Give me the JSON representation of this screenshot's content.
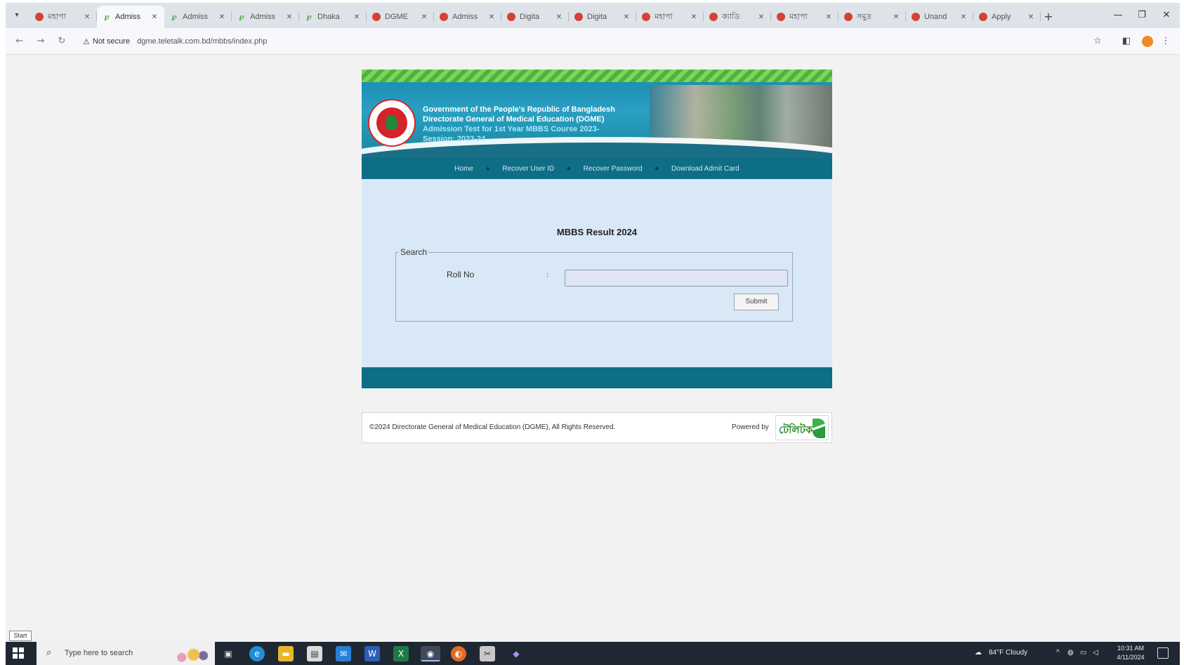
{
  "browser": {
    "tabs": [
      {
        "title": "মহাপা",
        "favicon": "red"
      },
      {
        "title": "Admiss",
        "favicon": "green",
        "active": true
      },
      {
        "title": "Admiss",
        "favicon": "green"
      },
      {
        "title": "Admiss",
        "favicon": "green"
      },
      {
        "title": "Dhaka",
        "favicon": "green"
      },
      {
        "title": "DGME",
        "favicon": "red"
      },
      {
        "title": "Admiss",
        "favicon": "red"
      },
      {
        "title": "Digita",
        "favicon": "red"
      },
      {
        "title": "Digita",
        "favicon": "red"
      },
      {
        "title": "মহাপা",
        "favicon": "red"
      },
      {
        "title": "ক্যাডি",
        "favicon": "red"
      },
      {
        "title": "মহাপা",
        "favicon": "red"
      },
      {
        "title": "সমুদ্র",
        "favicon": "red"
      },
      {
        "title": "Unand",
        "favicon": "red"
      },
      {
        "title": "Apply",
        "favicon": "red"
      }
    ],
    "security_label": "Not secure",
    "url": "dgme.teletalk.com.bd/mbbs/index.php",
    "accent": "#f08a24"
  },
  "site": {
    "header": {
      "line1": "Government of the People's Republic of Bangladesh",
      "line2": "Directorate General of Medical Education (DGME)",
      "line3": "Admission Test for 1st Year MBBS Course 2023-",
      "line4": "Session: 2023-24"
    },
    "nav": [
      "Home",
      "Recover User ID",
      "Recover Password",
      "Download Admit Card"
    ],
    "page_title": "MBBS Result 2024",
    "search": {
      "legend": "Search",
      "roll_label": "Roll No",
      "colon": ":",
      "roll_value": "",
      "submit_label": "Submit"
    },
    "footer": {
      "copyright": "©2024 Directorate General of Medical Education (DGME), All Rights Reserved.",
      "powered_label": "Powered by",
      "logo_text": "টেলিটক"
    },
    "colors": {
      "nav_bg": "#0e6e85",
      "content_bg": "#d9e8f7",
      "stripe_green": "#5cc04c"
    }
  },
  "desktop": {
    "start_tooltip": "Start",
    "search_placeholder": "Type here to search",
    "weather": "84°F  Cloudy",
    "clock_time": "10:31 AM",
    "clock_date": "4/11/2024"
  }
}
